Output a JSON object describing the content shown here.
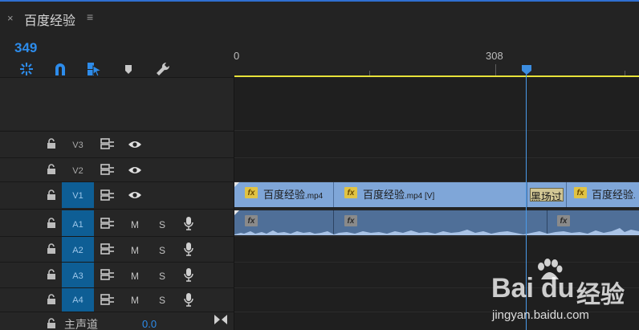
{
  "tab": {
    "close_glyph": "×",
    "title": "百度经验",
    "menu_glyph": "≡"
  },
  "timecode": "349",
  "toolbar": {
    "icons": [
      "nest-sequence-icon",
      "snap-magnet-icon",
      "linked-selection-icon",
      "add-marker-icon",
      "wrench-settings-icon"
    ]
  },
  "ruler": {
    "labels": [
      "0",
      "308"
    ]
  },
  "tracks": {
    "video": [
      {
        "id": "V3",
        "targeted": false
      },
      {
        "id": "V2",
        "targeted": false
      },
      {
        "id": "V1",
        "targeted": true
      }
    ],
    "audio": [
      {
        "id": "A1",
        "m": "M",
        "s": "S"
      },
      {
        "id": "A2",
        "m": "M",
        "s": "S"
      },
      {
        "id": "A3",
        "m": "M",
        "s": "S"
      },
      {
        "id": "A4",
        "m": "M",
        "s": "S"
      }
    ],
    "master": {
      "label": "主声道",
      "value": "0.0"
    }
  },
  "clips": {
    "video": [
      {
        "name": "百度经验",
        "ext": ".mp4"
      },
      {
        "name": "百度经验",
        "ext": ".mp4 [V]"
      },
      {
        "name": "百度经验",
        "ext": "."
      }
    ],
    "transition": "黑场过"
  },
  "fx_label": "fx",
  "watermark": {
    "logo_text": "Bai",
    "logo_text2": "du",
    "logo_cn": "经验",
    "url": "jingyan.baidu.com"
  },
  "colors": {
    "accent": "#2d8ceb",
    "video_clip": "#7fa6d8",
    "audio_clip": "#4f6f98",
    "target_track": "#0e5e95",
    "work_area": "#e8e23a",
    "playhead": "#4a9ae8"
  }
}
